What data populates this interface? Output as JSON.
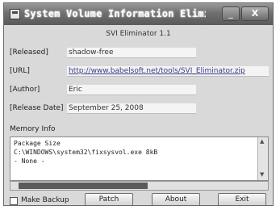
{
  "window": {
    "title": "System Volume Information Elimin...",
    "minimize_glyph": "_",
    "close_glyph": "X"
  },
  "header": {
    "subtitle": "SVI Eliminator 1.1"
  },
  "fields": {
    "released_label": "[Released]",
    "released_value": "shadow-free",
    "url_label": "[URL]",
    "url_value": "http://www.babelsoft.net/tools/SVI_Eliminator.zip",
    "author_label": "[Author]",
    "author_value": "Eric",
    "release_date_label": "[Release Date]",
    "release_date_value": "September 25, 2008"
  },
  "memo": {
    "label": "Memory Info",
    "lines": [
      "Package Size",
      "C:\\WINDOWS\\system32\\fixsysvol.exe 8kB",
      "  - None -"
    ]
  },
  "footer": {
    "checkbox_label": "Make Backup",
    "buttons": {
      "patch": "Patch",
      "about": "About",
      "exit": "Exit"
    }
  },
  "colors": {
    "titlebar": "#6f6f6f",
    "window_bg": "#d9d9d9",
    "scroll_thumb": "#5a5a5a"
  }
}
